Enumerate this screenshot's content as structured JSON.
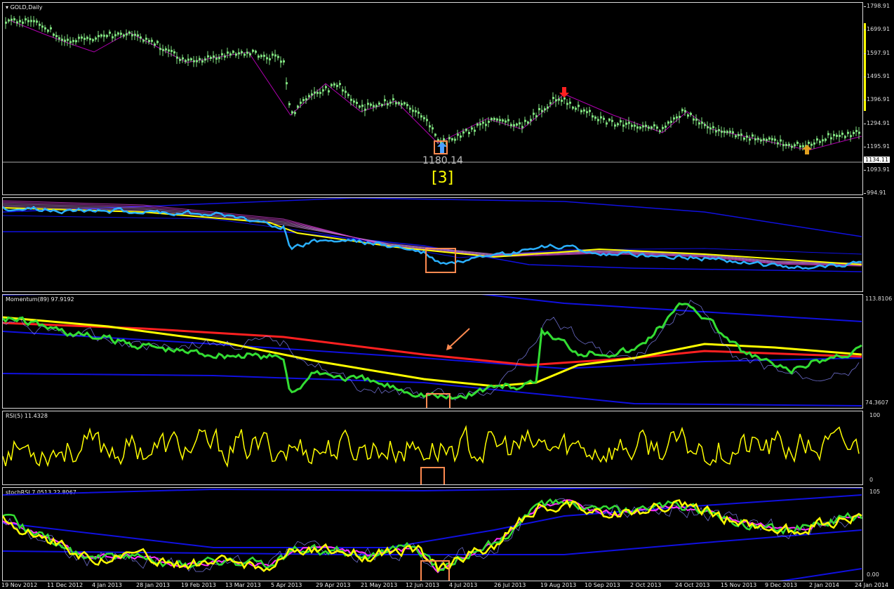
{
  "main": {
    "title": "GOLD,Daily",
    "price_annotation": "1180.14",
    "wave_label": "[3]",
    "current_price": "1134.11",
    "price_axis": [
      "1798.91",
      "1699.91",
      "1597.91",
      "1495.91",
      "1396.91",
      "1294.91",
      "1195.91",
      "1093.91",
      "994.91"
    ]
  },
  "momentum": {
    "title": "Momentum(89) 97.9192",
    "axis_top": "113.8106",
    "axis_bottom": "74.3607"
  },
  "rsi": {
    "title": "RSI(5) 11.4328",
    "axis_top": "100",
    "axis_bottom": "0"
  },
  "stochrsi": {
    "title": "stochRSI 7.0513 22.8067",
    "axis_top": "105",
    "axis_bottom": "0.00"
  },
  "dates": [
    "19 Nov 2012",
    "11 Dec 2012",
    "4 Jan 2013",
    "28 Jan 2013",
    "19 Feb 2013",
    "13 Mar 2013",
    "5 Apr 2013",
    "29 Apr 2013",
    "21 May 2013",
    "12 Jun 2013",
    "4 Jul 2013",
    "26 Jul 2013",
    "19 Aug 2013",
    "10 Sep 2013",
    "2 Oct 2013",
    "24 Oct 2013",
    "15 Nov 2013",
    "9 Dec 2013",
    "2 Jan 2014",
    "24 Jan 2014"
  ],
  "colors": {
    "candle": "#7fe07f",
    "zigzag": "#b000b0",
    "yellow": "#ffff00",
    "red": "#ff2020",
    "green": "#33dd33",
    "blue": "#1010e0",
    "cyan": "#2ab0ff",
    "magenta": "#ff30ff",
    "orange": "#ff8a50",
    "up_arrow": "#4aa0ff",
    "down_arrow": "#ff2020",
    "gold_arrow": "#e0a020"
  },
  "chart_data": [
    {
      "type": "line",
      "title": "GOLD,Daily",
      "x": [
        "19 Nov 2012",
        "11 Dec 2012",
        "4 Jan 2013",
        "28 Jan 2013",
        "19 Feb 2013",
        "13 Mar 2013",
        "5 Apr 2013",
        "29 Apr 2013",
        "21 May 2013",
        "12 Jun 2013",
        "4 Jul 2013",
        "26 Jul 2013",
        "19 Aug 2013",
        "10 Sep 2013",
        "2 Oct 2013",
        "24 Oct 2013",
        "15 Nov 2013",
        "9 Dec 2013",
        "2 Jan 2014",
        "24 Jan 2014"
      ],
      "series": [
        {
          "values": [
            1735,
            1700,
            1660,
            1680,
            1610,
            1600,
            1580,
            1470,
            1390,
            1280,
            1250,
            1320,
            1370,
            1360,
            1310,
            1345,
            1280,
            1230,
            1230,
            1265
          ]
        }
      ],
      "ylim": [
        994.91,
        1798.91
      ]
    },
    {
      "type": "line",
      "title": "RSI(5) 11.4328",
      "x": [
        "19 Nov 2012",
        "11 Dec 2012",
        "4 Jan 2013",
        "28 Jan 2013",
        "19 Feb 2013",
        "13 Mar 2013",
        "5 Apr 2013",
        "29 Apr 2013",
        "21 May 2013",
        "12 Jun 2013",
        "4 Jul 2013",
        "26 Jul 2013",
        "19 Aug 2013",
        "10 Sep 2013",
        "2 Oct 2013",
        "24 Oct 2013",
        "15 Nov 2013",
        "9 Dec 2013",
        "2 Jan 2014",
        "24 Jan 2014"
      ],
      "series": [
        {
          "values": [
            60,
            35,
            75,
            30,
            20,
            70,
            15,
            75,
            40,
            10,
            80,
            55,
            90,
            60,
            30,
            85,
            30,
            70,
            40,
            80
          ]
        }
      ],
      "ylim": [
        0,
        100
      ]
    }
  ]
}
